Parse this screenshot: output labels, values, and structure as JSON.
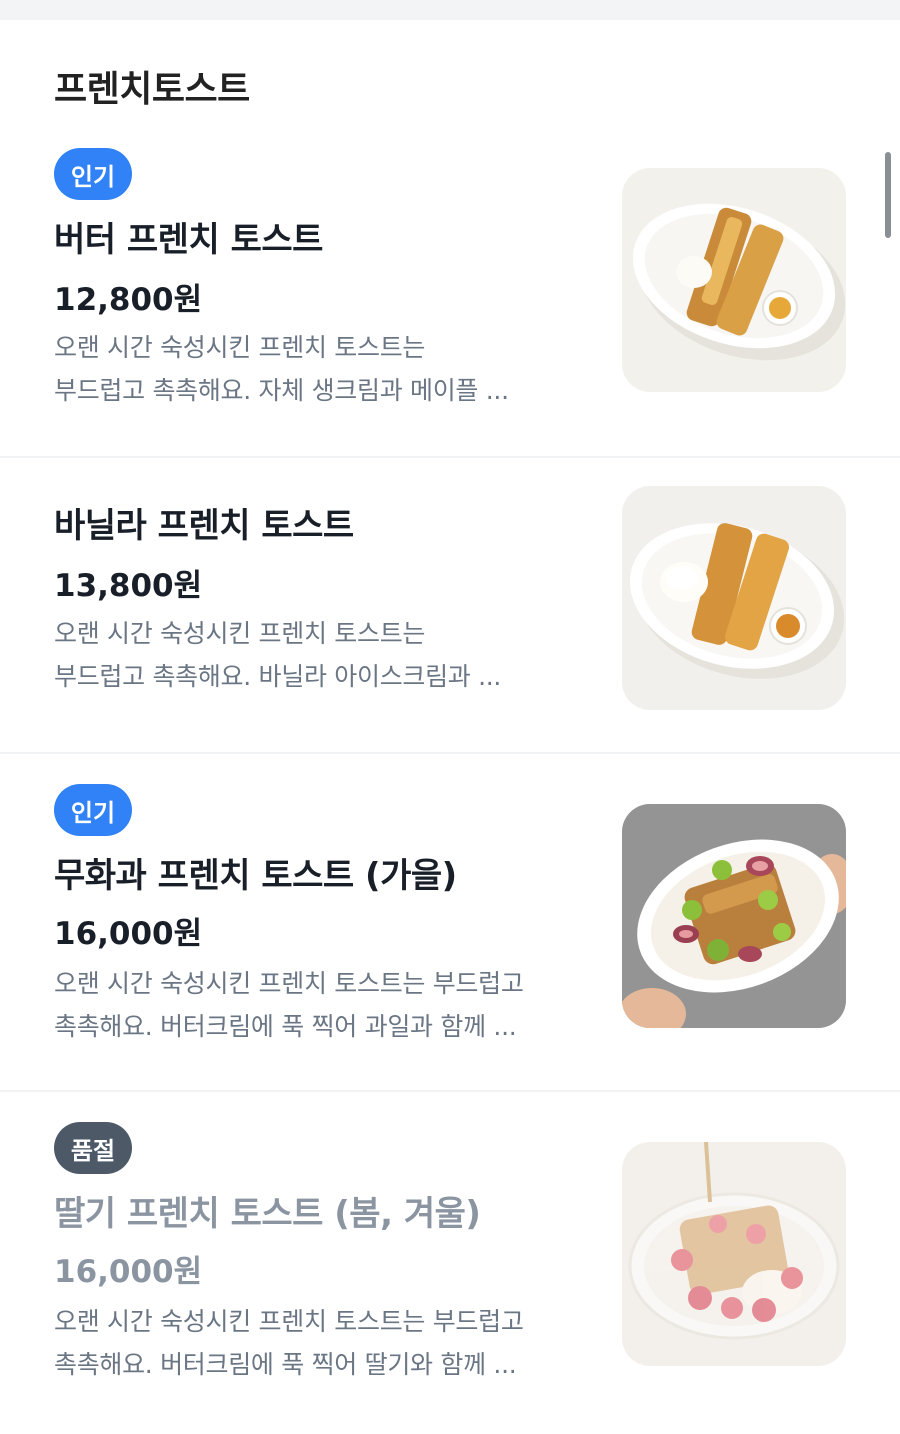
{
  "section": {
    "title": "프렌치토스트"
  },
  "items": [
    {
      "badge": "인기",
      "name": "버터 프렌치 토스트",
      "price": "12,800원",
      "desc_line1": "오랜 시간 숙성시킨 프렌치 토스트는",
      "desc_line2": "부드럽고 촉촉해요. 자체 생크림과 메이플 ...",
      "image": "butter-french-toast-photo"
    },
    {
      "badge": "",
      "name": "바닐라 프렌치 토스트",
      "price": "13,800원",
      "desc_line1": "오랜 시간 숙성시킨 프렌치 토스트는",
      "desc_line2": "부드럽고 촉촉해요. 바닐라 아이스크림과 ...",
      "image": "vanilla-french-toast-photo"
    },
    {
      "badge": "인기",
      "name": "무화과 프렌치 토스트 (가을)",
      "price": "16,000원",
      "desc_line1": "오랜 시간 숙성시킨 프렌치 토스트는 부드럽고",
      "desc_line2": "촉촉해요. 버터크림에 푹 찍어 과일과 함께 ...",
      "image": "fig-french-toast-photo"
    },
    {
      "badge": "품절",
      "name": "딸기 프렌치 토스트 (봄, 겨울)",
      "price": "16,000원",
      "desc_line1": "오랜 시간 숙성시킨 프렌치 토스트는 부드럽고",
      "desc_line2": "촉촉해요. 버터크림에 푹 찍어 딸기와 함께 ...",
      "image": "strawberry-french-toast-photo"
    }
  ],
  "colors": {
    "popular_badge": "#3182f6",
    "soldout_badge": "#4e5968",
    "text_primary": "#191f28",
    "text_secondary": "#6b7684",
    "text_disabled": "#8b95a1"
  }
}
